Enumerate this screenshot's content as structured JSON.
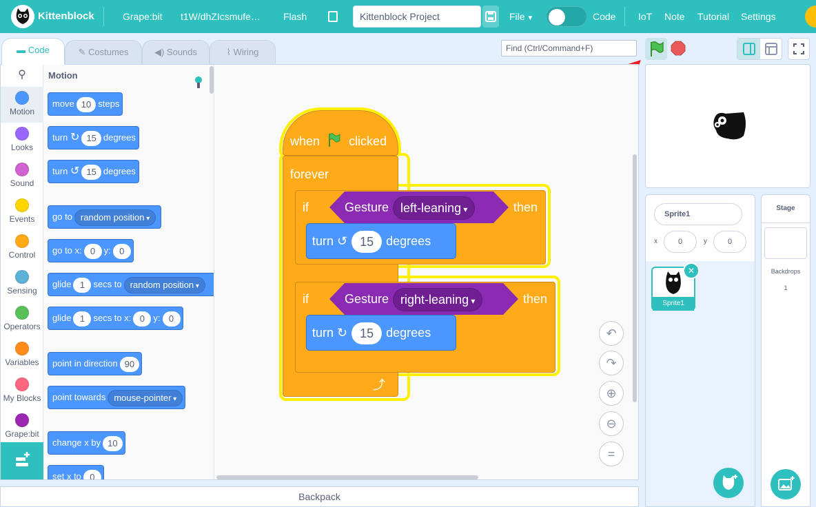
{
  "app": {
    "name": "Kittenblock"
  },
  "topbar": {
    "device": "Grape:bit",
    "connection_id": "t1W/dhZIcsmufe…",
    "flash": "Flash",
    "project_name": "Kittenblock Project",
    "file": "File",
    "code": "Code",
    "iot": "IoT",
    "note": "Note",
    "tutorial": "Tutorial",
    "settings": "Settings"
  },
  "tabs": [
    {
      "label": "Code",
      "icon": "code-icon"
    },
    {
      "label": "Costumes",
      "icon": "brush-icon"
    },
    {
      "label": "Sounds",
      "icon": "speaker-icon"
    },
    {
      "label": "Wiring",
      "icon": "wiring-icon"
    }
  ],
  "find": {
    "placeholder": "Find (Ctrl/Command+F)"
  },
  "categories": [
    {
      "label": "Motion",
      "color": "#4c97ff"
    },
    {
      "label": "Looks",
      "color": "#9966ff"
    },
    {
      "label": "Sound",
      "color": "#cf63cf"
    },
    {
      "label": "Events",
      "color": "#ffd500"
    },
    {
      "label": "Control",
      "color": "#ffab19"
    },
    {
      "label": "Sensing",
      "color": "#5cb1d6"
    },
    {
      "label": "Operators",
      "color": "#59c059"
    },
    {
      "label": "Variables",
      "color": "#ff8c1a"
    },
    {
      "label": "My Blocks",
      "color": "#ff6680"
    },
    {
      "label": "Grape:bit",
      "color": "#9c27b0"
    }
  ],
  "palette": {
    "heading": "Motion",
    "move": {
      "a": "move",
      "n": "10",
      "b": "steps"
    },
    "turn_right": {
      "a": "turn",
      "n": "15",
      "b": "degrees"
    },
    "turn_left": {
      "a": "turn",
      "n": "15",
      "b": "degrees"
    },
    "goto": {
      "a": "go to",
      "dd": "random position"
    },
    "goto_xy": {
      "a": "go to x:",
      "x": "0",
      "ylab": "y:",
      "y": "0"
    },
    "glide": {
      "a": "glide",
      "n": "1",
      "b": "secs to",
      "dd": "random position"
    },
    "glide_xy": {
      "a": "glide",
      "n": "1",
      "b": "secs to x:",
      "x": "0",
      "ylab": "y:",
      "y": "0"
    },
    "point_dir": {
      "a": "point in direction",
      "n": "90"
    },
    "point_towards": {
      "a": "point towards",
      "dd": "mouse-pointer"
    },
    "change_x": {
      "a": "change x by",
      "n": "10"
    },
    "set_x": {
      "a": "set x to",
      "n": "0"
    }
  },
  "script": {
    "hat_when": "when",
    "hat_clicked": "clicked",
    "forever": "forever",
    "if1": {
      "if": "if",
      "gesture": "Gesture",
      "value": "left-leaning",
      "then": "then",
      "turn": "turn",
      "deg": "15",
      "degrees": "degrees"
    },
    "if2": {
      "if": "if",
      "gesture": "Gesture",
      "value": "right-leaning",
      "then": "then",
      "turn": "turn",
      "deg": "15",
      "degrees": "degrees"
    }
  },
  "sprite_panel": {
    "name": "Sprite1",
    "x_label": "x",
    "x": "0",
    "y_label": "y",
    "y": "0",
    "thumb_label": "Sprite1"
  },
  "stage_panel": {
    "title": "Stage",
    "backdrops_label": "Backdrops",
    "backdrops_count": "1"
  },
  "backpack": {
    "label": "Backpack"
  },
  "colors": {
    "teal": "#2ebfbf",
    "motion": "#4c97ff",
    "control": "#ffab19",
    "gesture": "#8b2bb3",
    "highlight": "#ffef00",
    "annotation": "#ee1c24"
  }
}
